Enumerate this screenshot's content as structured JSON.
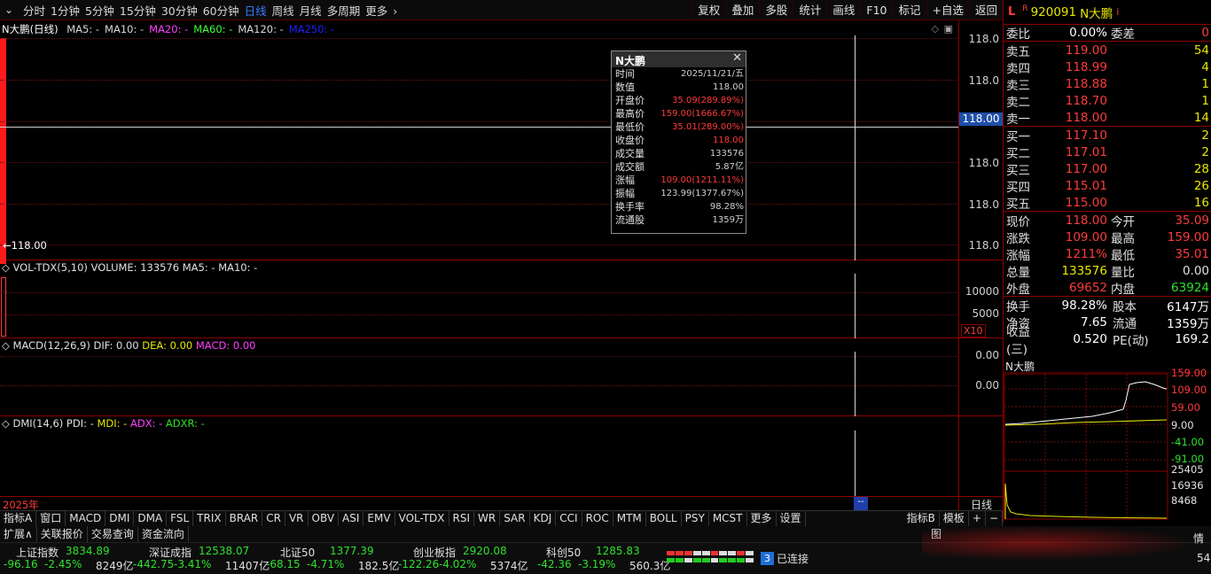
{
  "toolbar": {
    "periods": [
      "分时",
      "1分钟",
      "5分钟",
      "15分钟",
      "30分钟",
      "60分钟",
      "日线",
      "周线",
      "月线",
      "多周期",
      "更多"
    ],
    "active_period": "日线",
    "right_buttons": [
      "复权",
      "叠加",
      "多股",
      "统计",
      "画线",
      "F10",
      "标记",
      "+自选",
      "返回"
    ]
  },
  "chart": {
    "title": "N大鹏(日线)",
    "ma": [
      {
        "label": "MA5: -",
        "color": "#d8d8d8"
      },
      {
        "label": "MA10: -",
        "color": "#d8d8d8"
      },
      {
        "label": "MA20: -",
        "color": "#ff40ff"
      },
      {
        "label": "MA60: -",
        "color": "#3cff3c"
      },
      {
        "label": "MA120: -",
        "color": "#d8d8d8"
      },
      {
        "label": "MA250: -",
        "color": "#2020ff"
      }
    ],
    "price_axis": [
      "118.0",
      "118.0",
      "118.0",
      "118.0",
      "118.0",
      "118.0"
    ],
    "price_highlight": "118.00",
    "last_price_label": "←118.00",
    "year_label": "2025年",
    "vol_header": "VOL-TDX(5,10) VOLUME: 133576 MA5: - MA10: -",
    "vol_axis": [
      "10000",
      "5000"
    ],
    "vol_unit": "X10",
    "macd_header": {
      "name": "MACD(12,26,9)",
      "dif": "DIF: 0.00",
      "dea": "DEA: 0.00",
      "macd": "MACD: 0.00"
    },
    "macd_axis": [
      "0.00",
      "0.00"
    ],
    "dmi_header": {
      "name": "DMI(14,6)",
      "pdi": "PDI: -",
      "mdi": "MDI: -",
      "adx": "ADX: -",
      "adxr": "ADXR: -"
    },
    "period_badge": "日线",
    "cursor_badge": "--"
  },
  "tooltip": {
    "title": "N大鹏",
    "rows": [
      {
        "k": "时间",
        "v": "2025/11/21/五",
        "c": "#d0d0d0"
      },
      {
        "k": "数值",
        "v": "118.00",
        "c": "#d0d0d0"
      },
      {
        "k": "开盘价",
        "v": "35.09(289.89%)",
        "c": "#ff3b3b"
      },
      {
        "k": "最高价",
        "v": "159.00(1666.67%)",
        "c": "#ff3b3b"
      },
      {
        "k": "最低价",
        "v": "35.01(289.00%)",
        "c": "#ff3b3b"
      },
      {
        "k": "收盘价",
        "v": "118.00",
        "c": "#ff3b3b"
      },
      {
        "k": "成交量",
        "v": "133576",
        "c": "#d0d0d0"
      },
      {
        "k": "成交额",
        "v": "5.87亿",
        "c": "#d0d0d0"
      },
      {
        "k": "涨幅",
        "v": "109.00(1211.11%)",
        "c": "#ff3b3b"
      },
      {
        "k": "振幅",
        "v": "123.99(1377.67%)",
        "c": "#d0d0d0"
      },
      {
        "k": "换手率",
        "v": "98.28%",
        "c": "#d0d0d0"
      },
      {
        "k": "流通股",
        "v": "1359万",
        "c": "#d0d0d0"
      }
    ]
  },
  "quote": {
    "badge_l": "L",
    "badge_r": "R",
    "code": "920091",
    "name": "N大鹏",
    "info": "i",
    "weibi": {
      "k": "委比",
      "v": "0.00%",
      "k2": "委差",
      "v2": "0"
    },
    "asks": [
      {
        "k": "卖五",
        "p": "119.00",
        "q": "54"
      },
      {
        "k": "卖四",
        "p": "118.99",
        "q": "4"
      },
      {
        "k": "卖三",
        "p": "118.88",
        "q": "1"
      },
      {
        "k": "卖二",
        "p": "118.70",
        "q": "1"
      },
      {
        "k": "卖一",
        "p": "118.00",
        "q": "14"
      }
    ],
    "bids": [
      {
        "k": "买一",
        "p": "117.10",
        "q": "2"
      },
      {
        "k": "买二",
        "p": "117.01",
        "q": "2"
      },
      {
        "k": "买三",
        "p": "117.00",
        "q": "28"
      },
      {
        "k": "买四",
        "p": "115.01",
        "q": "26"
      },
      {
        "k": "买五",
        "p": "115.00",
        "q": "16"
      }
    ],
    "stats": [
      {
        "k": "现价",
        "v": "118.00",
        "vc": "#ff3b3b",
        "k2": "今开",
        "v2": "35.09",
        "v2c": "#ff3b3b"
      },
      {
        "k": "涨跌",
        "v": "109.00",
        "vc": "#ff3b3b",
        "k2": "最高",
        "v2": "159.00",
        "v2c": "#ff3b3b"
      },
      {
        "k": "涨幅",
        "v": "1211%",
        "vc": "#ff3b3b",
        "k2": "最低",
        "v2": "35.01",
        "v2c": "#ff3b3b"
      },
      {
        "k": "总量",
        "v": "133576",
        "vc": "#e8e800",
        "k2": "量比",
        "v2": "0.00",
        "v2c": "#e0e0e0"
      },
      {
        "k": "外盘",
        "v": "69652",
        "vc": "#ff3b3b",
        "k2": "内盘",
        "v2": "63924",
        "v2c": "#2ee02e"
      }
    ],
    "fin": [
      {
        "k": "换手",
        "v": "98.28%",
        "k2": "股本",
        "v2": "6147万"
      },
      {
        "k": "净资",
        "v": "7.65",
        "k2": "流通",
        "v2": "1359万"
      },
      {
        "k": "收益(三)",
        "v": "0.520",
        "k2": "PE(动)",
        "v2": "169.2"
      }
    ]
  },
  "mini_chart": {
    "title": "N大鹏",
    "price_axis": [
      "159.00",
      "109.00",
      "59.00",
      "9.00",
      "-41.00",
      "-91.00"
    ],
    "vol_axis": [
      "25405",
      "16936",
      "8468"
    ]
  },
  "bottom_tabs": [
    "指标A",
    "窗口",
    "MACD",
    "DMI",
    "DMA",
    "FSL",
    "TRIX",
    "BRAR",
    "CR",
    "VR",
    "OBV",
    "ASI",
    "EMV",
    "VOL-TDX",
    "RSI",
    "WR",
    "SAR",
    "KDJ",
    "CCI",
    "ROC",
    "MTM",
    "BOLL",
    "PSY",
    "MCST",
    "更多",
    "设置"
  ],
  "bottom_tabs_right": [
    "指标B",
    "模板",
    "+",
    "−"
  ],
  "bottom_links": [
    "扩展∧",
    "关联报价",
    "交易查询",
    "资金流向"
  ],
  "bottom_right_label": "图",
  "indices": [
    {
      "name": "上证指数",
      "val": "3834.89",
      "chg": "-96.16",
      "pct": "-2.45%",
      "amt": "8249亿"
    },
    {
      "name": "深证成指",
      "val": "12538.07",
      "chg": "-442.75",
      "pct": "-3.41%",
      "amt": "11407亿"
    },
    {
      "name": "北证50",
      "val": "1377.39",
      "chg": "-68.15",
      "pct": "-4.71%",
      "amt": "182.5亿"
    },
    {
      "name": "创业板指",
      "val": "2920.08",
      "chg": "-122.26",
      "pct": "-4.02%",
      "amt": "5374亿"
    },
    {
      "name": "科创50",
      "val": "1285.83",
      "chg": "-42.36",
      "pct": "-3.19%",
      "amt": "560.3亿"
    }
  ],
  "connection": {
    "count": "3",
    "label": "已连接"
  },
  "status_right": {
    "top": "情",
    "bottom": "54"
  }
}
